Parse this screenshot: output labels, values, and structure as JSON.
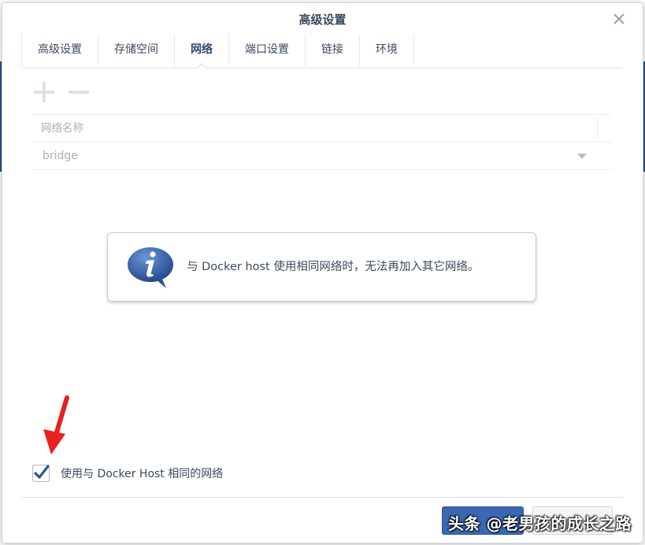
{
  "dialog": {
    "title": "高级设置",
    "close_icon": "close-icon"
  },
  "tabs": [
    {
      "label": "高级设置",
      "active": false
    },
    {
      "label": "存储空间",
      "active": false
    },
    {
      "label": "网络",
      "active": true
    },
    {
      "label": "端口设置",
      "active": false
    },
    {
      "label": "链接",
      "active": false
    },
    {
      "label": "环境",
      "active": false
    }
  ],
  "toolbar": {
    "add_icon": "plus-icon",
    "remove_icon": "minus-icon"
  },
  "network_table": {
    "header": "网络名称",
    "rows": [
      {
        "name": "bridge"
      }
    ]
  },
  "info": {
    "icon": "info-icon",
    "message": "与 Docker host 使用相同网络时，无法再加入其它网络。"
  },
  "use_host_network": {
    "checked": true,
    "label": "使用与 Docker Host 相同的网络"
  },
  "watermark": {
    "text": "头条 @老男孩的成长之路"
  },
  "colors": {
    "accent": "#3b68b2",
    "title": "#3c4a5e",
    "disabled": "#a9b0b8",
    "annotation_arrow": "#e8201f"
  }
}
